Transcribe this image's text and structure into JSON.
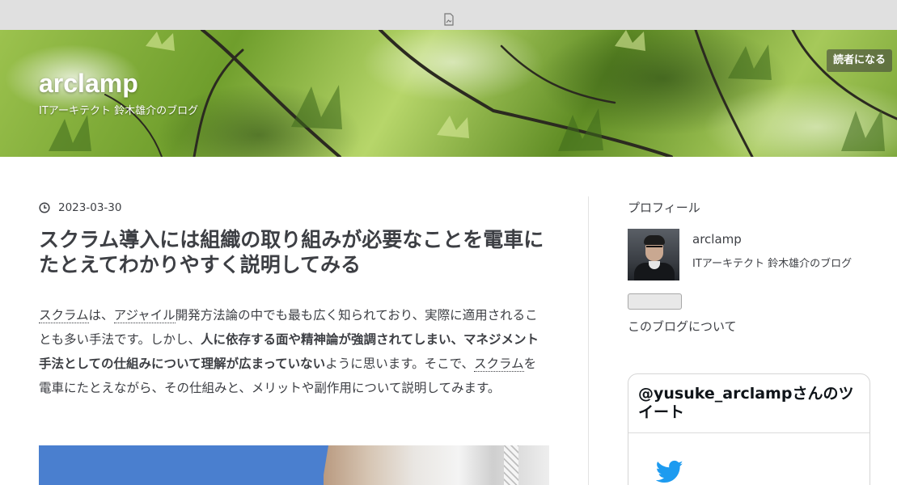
{
  "toolbar": {
    "icon": "document-icon"
  },
  "header": {
    "site_title": "arclamp",
    "site_description": "ITアーキテクト 鈴木雄介のブログ",
    "subscribe_label": "読者になる"
  },
  "entry": {
    "date": "2023-03-30",
    "title": "スクラム導入には組織の取り組みが必要なことを電車にたとえてわかりやすく説明してみる",
    "body": {
      "link_scrum": "スクラム",
      "t1": "は、",
      "link_agile": "アジャイル",
      "t2": "開発方法論の中でも最も広く知られており、実際に適用されることも多い手法です。しかし、",
      "bold": "人に依存する面や精神論が強調されてしまい、マネジメント手法としての仕組みについて理解が広まっていない",
      "t3": "ように思います。そこで、",
      "link_scrum2": "スクラム",
      "t4": "を電車にたとえながら、その仕組みと、メリットや副作用について説明してみます。"
    }
  },
  "sidebar": {
    "profile_heading": "プロフィール",
    "profile_name": "arclamp",
    "profile_description": "ITアーキテクト 鈴木雄介のブログ",
    "about_link": "このブログについて",
    "twitter_title": "@yusuke_arclampさんのツイート",
    "twitter_icon": "twitter-bird-icon"
  },
  "colors": {
    "text": "#3d3f44",
    "toolbar": "#e0e0e0",
    "twitter_blue": "#1d9bf0",
    "image_blue": "#4a7fcf"
  }
}
